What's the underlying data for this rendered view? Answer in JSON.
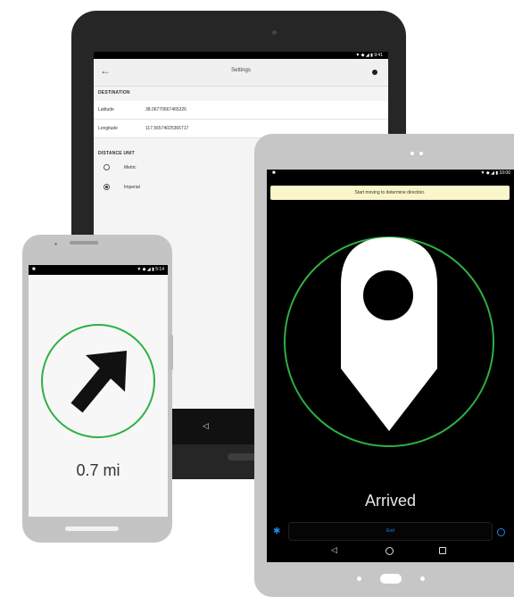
{
  "back_tablet": {
    "status_icons": "▼ ◆ ◢ ▮ 9:41",
    "back_icon": "←",
    "title": "Settings",
    "destination_section": "DESTINATION",
    "latitude_label": "Latitude",
    "latitude_value": "38.06770667465326",
    "longitude_label": "Longitude",
    "longitude_value": "117.56574025365717",
    "distance_unit_section": "DISTANCE UNIT",
    "metric_label": "Metric",
    "imperial_label": "Imperial",
    "selected_unit": "Imperial",
    "nav_back_icon": "◁"
  },
  "phone": {
    "status_left": "■",
    "status_right": "▼ ◆ ◢ ▮ 5:14",
    "distance": "0.7 mi",
    "ring_color": "#2db043",
    "arrow_icon": "direction-arrow-northeast"
  },
  "front_tablet": {
    "status_left": "■",
    "status_right": "▼ ◆ ◢ ▮ 10:06",
    "banner_text": "Start moving to determine direction.",
    "status_text": "Arrived",
    "end_button_label": "End",
    "settings_icon": "✱",
    "ring_color": "#2db043",
    "accent_color": "#1e88e5",
    "nav_back_icon": "◁"
  }
}
